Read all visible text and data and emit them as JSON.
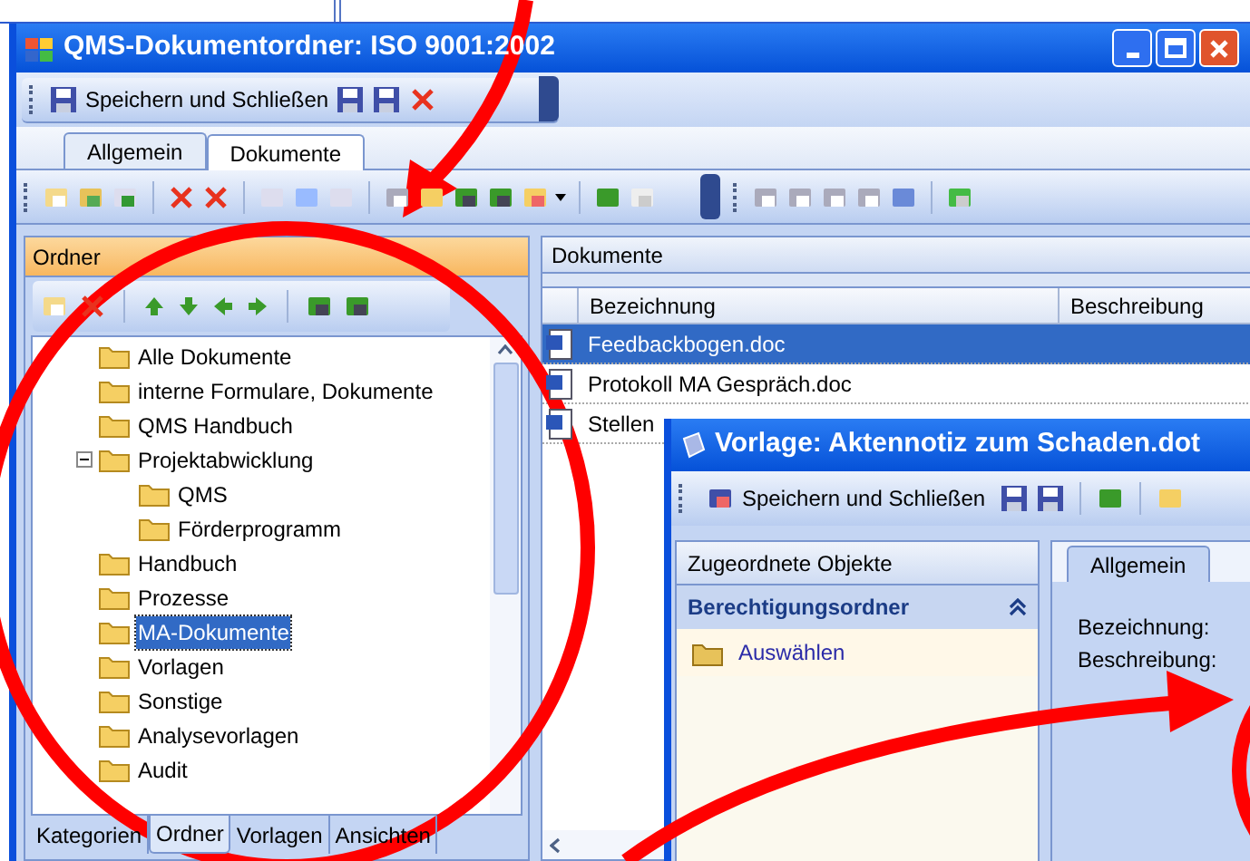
{
  "window": {
    "title": "QMS-Dokumentordner: ISO 9001:2002"
  },
  "toolbar": {
    "save_close": "Speichern und Schließen"
  },
  "tabs": [
    {
      "label": "Allgemein",
      "selected": false
    },
    {
      "label": "Dokumente",
      "selected": true
    }
  ],
  "folder_panel": {
    "title": "Ordner",
    "tree": [
      {
        "label": "Alle Dokumente",
        "selected": false
      },
      {
        "label": "interne Formulare, Dokumente",
        "selected": false
      },
      {
        "label": "QMS Handbuch",
        "selected": false
      },
      {
        "label": "Projektabwicklung",
        "selected": false,
        "expanded": true,
        "children": [
          {
            "label": "QMS",
            "selected": false
          },
          {
            "label": "Förderprogramm",
            "selected": false
          }
        ]
      },
      {
        "label": "Handbuch",
        "selected": false
      },
      {
        "label": "Prozesse",
        "selected": false
      },
      {
        "label": "MA-Dokumente",
        "selected": true
      },
      {
        "label": "Vorlagen",
        "selected": false
      },
      {
        "label": "Sonstige",
        "selected": false
      },
      {
        "label": "Analysevorlagen",
        "selected": false
      },
      {
        "label": "Audit",
        "selected": false
      }
    ],
    "bottom_tabs": [
      {
        "label": "Kategorien",
        "selected": false
      },
      {
        "label": "Ordner",
        "selected": true
      },
      {
        "label": "Vorlagen",
        "selected": false
      },
      {
        "label": "Ansichten",
        "selected": false
      }
    ]
  },
  "documents_panel": {
    "title": "Dokumente",
    "columns": [
      "Bezeichnung",
      "Beschreibung"
    ],
    "rows": [
      {
        "name": "Feedbackbogen.doc",
        "selected": true
      },
      {
        "name": "Protokoll MA Gespräch.doc",
        "selected": false
      },
      {
        "name": "Stellen",
        "selected": false
      }
    ]
  },
  "dialog": {
    "title": "Vorlage: Aktennotiz zum Schaden.dot",
    "save_close": "Speichern und Schließen",
    "side_panel": {
      "title": "Zugeordnete Objekte",
      "group": {
        "title": "Berechtigungsordner",
        "expanded": true,
        "items": [
          "Auswählen"
        ]
      }
    },
    "tabs": [
      {
        "label": "Allgemein",
        "selected": true
      }
    ],
    "fields": [
      "Bezeichnung:",
      "Beschreibung:"
    ]
  }
}
